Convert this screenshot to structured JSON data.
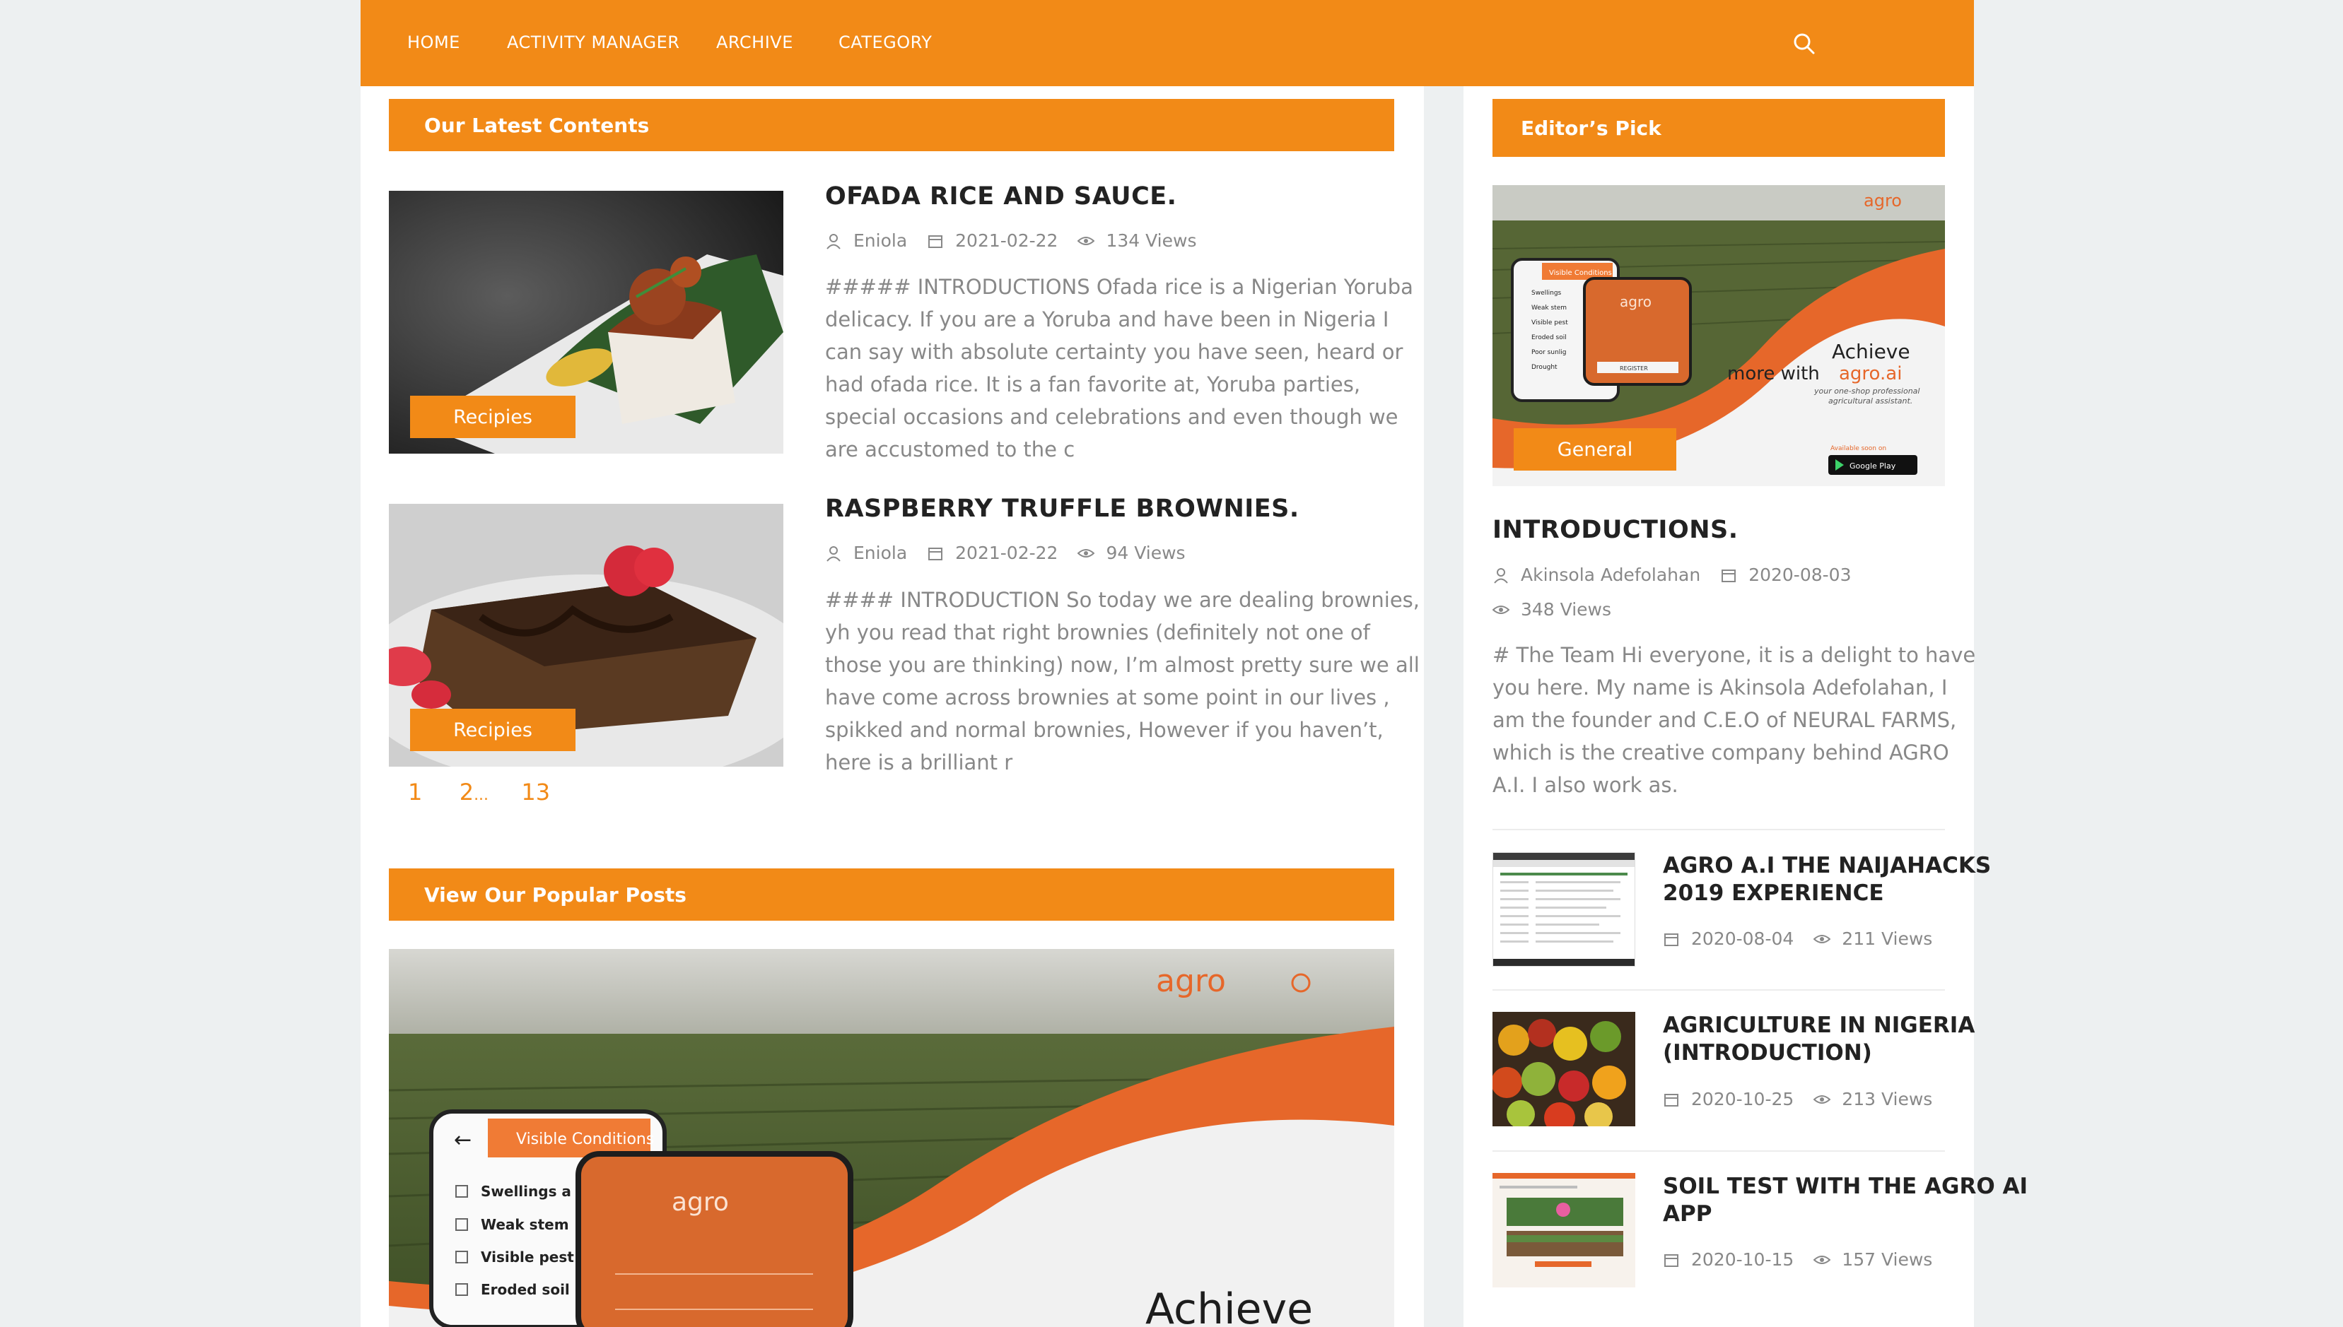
{
  "nav": {
    "items": [
      "HOME",
      "ACTIVITY MANAGER",
      "ARCHIVE",
      "CATEGORY"
    ],
    "search_icon": "search-icon"
  },
  "latest": {
    "heading": "Our Latest Contents",
    "posts": [
      {
        "title": "OFADA RICE AND SAUCE.",
        "author": "Eniola",
        "date": "2021-02-22",
        "views": "134 Views",
        "badge": "Recipies",
        "excerpt_lines": [
          "##### INTRODUCTIONS Ofada rice is a Nigerian Yoruba",
          "delicacy. If you are a Yoruba and have been in Nigeria I",
          "can say with absolute certainty you have seen, heard or",
          "had ofada rice. It is a fan favorite at, Yoruba parties,",
          "special occasions and celebrations and even though we",
          "are accustomed to the c"
        ]
      },
      {
        "title": "RASPBERRY TRUFFLE BROWNIES.",
        "author": "Eniola",
        "date": "2021-02-22",
        "views": "94 Views",
        "badge": "Recipies",
        "excerpt_lines": [
          "#### INTRODUCTION So today we are dealing brownies,",
          "yh you read that right brownies (definitely not one of",
          "those you are thinking) now, I’m almost pretty sure we all",
          "have come across brownies at some point in our lives ,",
          "spikked and normal brownies, However if you haven’t,",
          "here is a brilliant r"
        ]
      }
    ],
    "pager": {
      "p1": "1",
      "p2": "2",
      "ellipsis": "...",
      "last": "13"
    }
  },
  "popular": {
    "heading": "View Our Popular Posts",
    "banner": {
      "brand": "agro",
      "panel_title": "Visible Conditions",
      "list": [
        "Swellings a",
        "Weak stem",
        "Visible pest",
        "Eroded soil"
      ],
      "phone_brand": "agro",
      "headline": "Achieve"
    }
  },
  "editors_pick": {
    "heading": "Editor’s Pick",
    "badge": "General",
    "image": {
      "brand": "agro",
      "line1": "Achieve",
      "line2a": "more with",
      "line2b": "agro.ai",
      "tagline1": "your one-shop professional",
      "tagline2": "agricultural assistant.",
      "store_small": "Available soon on",
      "store": "Google Play",
      "phone_title": "Visible Conditions",
      "phone_items": [
        "Swellings",
        "Weak stem",
        "Visible pest",
        "Eroded soil",
        "Poor sunlig",
        "Drought"
      ],
      "phone_brand": "agro",
      "phone_button": "REGISTER"
    },
    "title": "INTRODUCTIONS.",
    "author": "Akinsola Adefolahan",
    "date": "2020-08-03",
    "views": "348 Views",
    "excerpt_lines": [
      "# The Team Hi everyone, it is a delight to have",
      "you here. My name is Akinsola Adefolahan, I",
      "am the founder and C.E.O of NEURAL FARMS,",
      "which is the creative company behind AGRO",
      "A.I. I also work as."
    ],
    "list": [
      {
        "title_lines": [
          "AGRO A.I THE NAIJAHACKS",
          "2019 EXPERIENCE"
        ],
        "date": "2020-08-04",
        "views": "211 Views"
      },
      {
        "title_lines": [
          "AGRICULTURE IN NIGERIA",
          "(INTRODUCTION)"
        ],
        "date": "2020-10-25",
        "views": "213 Views"
      },
      {
        "title_lines": [
          "SOIL TEST WITH THE AGRO AI",
          "APP"
        ],
        "date": "2020-10-15",
        "views": "157 Views"
      }
    ]
  },
  "colors": {
    "accent": "#f28a17",
    "text_muted": "#888888",
    "background": "#edf0f1"
  }
}
